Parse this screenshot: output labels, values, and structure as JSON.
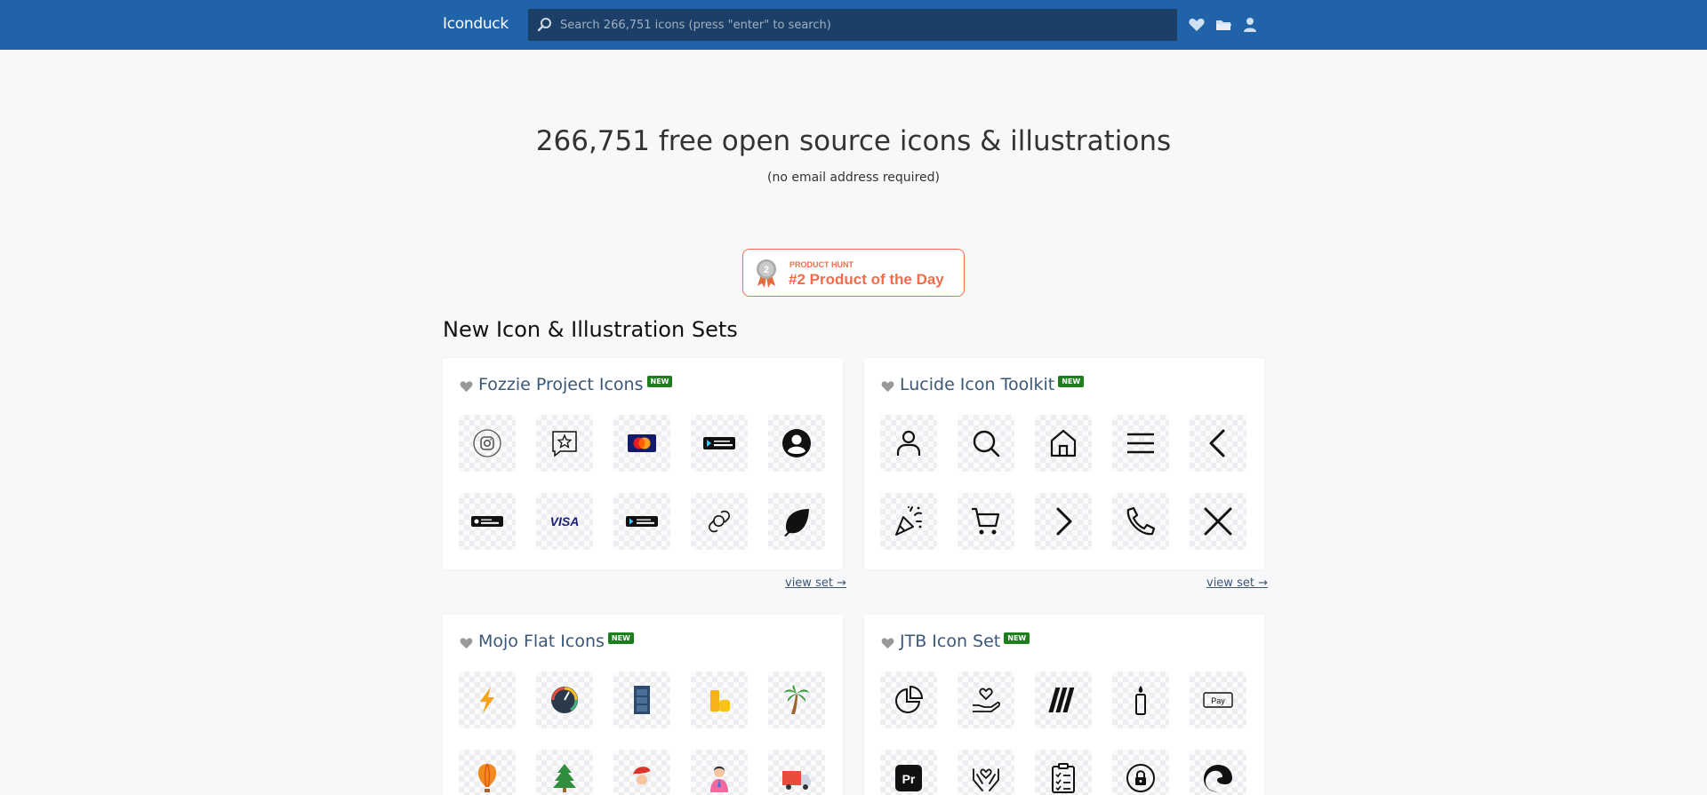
{
  "header": {
    "brand": "Iconduck",
    "search_placeholder": "Search 266,751 icons (press \"enter\" to search)",
    "nav_icons": [
      "heart-icon",
      "folder-icon",
      "user-icon"
    ]
  },
  "hero": {
    "title": "266,751 free open source icons & illustrations",
    "subtitle": "(no email address required)"
  },
  "product_hunt": {
    "label": "PRODUCT HUNT",
    "title": "#2 Product of the Day",
    "medal_number": "2"
  },
  "section": {
    "title": "New Icon & Illustration Sets"
  },
  "sets": [
    {
      "name": "Fozzie Project Icons",
      "badge": "NEW",
      "view_label": "view set →",
      "icons": [
        "instagram-icon",
        "star-chat-icon",
        "mastercard-icon",
        "google-play-badge-icon",
        "user-circle-icon",
        "app-store-badge-icon",
        "visa-icon",
        "google-play-badge-icon",
        "chain-link-icon",
        "leaf-icon"
      ]
    },
    {
      "name": "Lucide Icon Toolkit",
      "badge": "NEW",
      "view_label": "view set →",
      "icons": [
        "user-icon",
        "search-icon",
        "home-icon",
        "menu-icon",
        "chevron-left-icon",
        "party-popper-icon",
        "shopping-cart-icon",
        "chevron-right-icon",
        "phone-icon",
        "close-icon"
      ]
    },
    {
      "name": "Mojo Flat Icons",
      "badge": "NEW",
      "view_label": "view set →",
      "icons": [
        "lightning-icon",
        "speedometer-icon",
        "film-strip-icon",
        "coins-icon",
        "palm-tree-icon",
        "hot-air-balloon-icon",
        "christmas-tree-icon",
        "santa-icon",
        "person-icon",
        "delivery-truck-icon"
      ]
    },
    {
      "name": "JTB Icon Set",
      "badge": "NEW",
      "view_label": "view set →",
      "icons": [
        "pie-chart-icon",
        "hand-heart-icon",
        "miro-logo-icon",
        "candle-icon",
        "apple-pay-icon",
        "premiere-pro-icon",
        "hands-heart-icon",
        "clipboard-checklist-icon",
        "lock-circle-icon",
        "edge-browser-icon"
      ]
    }
  ],
  "colors": {
    "header": "#2063a8",
    "search": "#1b3f66",
    "accent_orange": "#f16c4a",
    "new_badge": "#1e7e1e",
    "link": "#3a5778"
  }
}
